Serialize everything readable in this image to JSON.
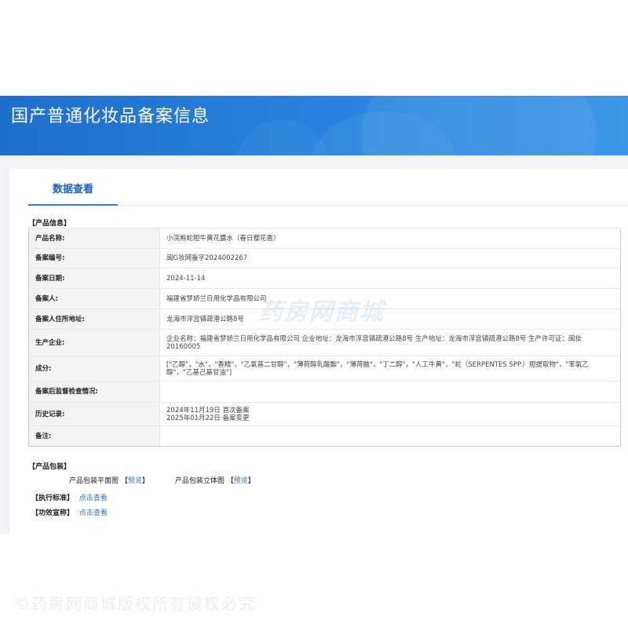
{
  "header": {
    "title": "国产普通化妆品备案信息"
  },
  "tabs": [
    {
      "label": "数据查看"
    }
  ],
  "product_info": {
    "section_label": "【产品信息】",
    "rows": [
      {
        "key": "产品名称:",
        "value": "小浣熊蛇胆牛黄花露水（春日樱花香）"
      },
      {
        "key": "备案编号:",
        "value": "闽G妆网备字2024002267"
      },
      {
        "key": "备案日期:",
        "value": "2024-11-14"
      },
      {
        "key": "备案人:",
        "value": "福建省梦娇兰日用化学品有限公司"
      },
      {
        "key": "备案人住所地址:",
        "value": "龙海市浮宫镇疏港公路8号"
      },
      {
        "key": "生产企业:",
        "value": "企业名称：福建省梦娇兰日用化学品有限公司 企业地址：龙海市浮宫镇疏港公路8号 生产地址：龙海市浮宫镇疏港公路8号 生产许可证：闽妆20160005"
      },
      {
        "key": "成分:",
        "value": "[\"乙醇\"，\"水\"，\"香精\"，\"乙氧基二甘醇\"，\"薄荷醇乳酸酯\"，\"薄荷脑\"，\"丁二醇\"，\"人工牛黄\"，\"蛇（SERPENTES SPP.）胆提取物\"，\"苯氧乙醇\"，\"乙基己基甘油\"]"
      },
      {
        "key": "备案后监督检查情况:",
        "value": ""
      },
      {
        "key": "历史记录:",
        "value": "2024年11月19日 首次备案\n2025年01月22日 备案变更"
      },
      {
        "key": "备注:",
        "value": ""
      }
    ]
  },
  "packaging": {
    "section_label": "【产品包装】",
    "items": [
      {
        "label": "产品包装平面图",
        "link": "预览"
      },
      {
        "label": "产品包装立体图",
        "link": "预览"
      }
    ]
  },
  "standard": {
    "label": "【执行标准】",
    "link": "点击查看"
  },
  "claims": {
    "label": "【功效宣称】",
    "link": "点击查看"
  },
  "watermarks": {
    "middle": "药房网商城",
    "bottom": "©药房网商城版权所有侵权必究"
  },
  "colors": {
    "banner": "#2a84df",
    "accent": "#1b63b8",
    "link": "#2a73c9",
    "table_border": "#b7cbe0"
  }
}
